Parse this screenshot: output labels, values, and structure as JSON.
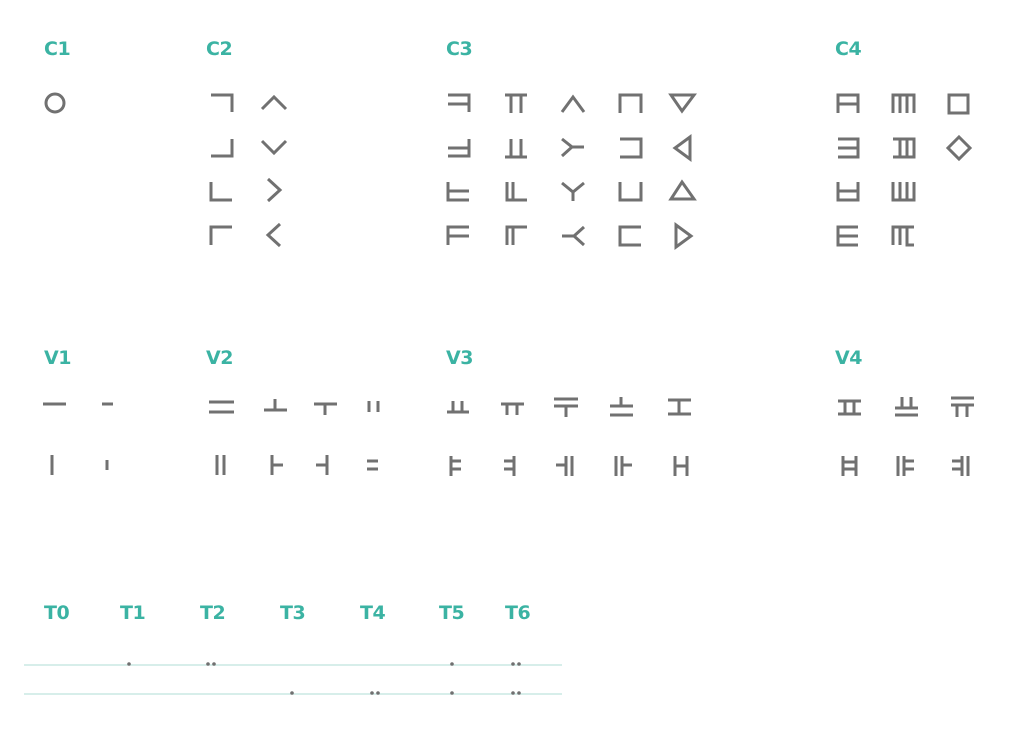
{
  "colors": {
    "accent": "#3bb3a3",
    "glyph": "#717171",
    "rule": "#bfe3dd",
    "dot": "#707070"
  },
  "headers": {
    "c1": "C1",
    "c2": "C2",
    "c3": "C3",
    "c4": "C4",
    "v1": "V1",
    "v2": "V2",
    "v3": "V3",
    "v4": "V4",
    "t0": "T0",
    "t1": "T1",
    "t2": "T2",
    "t3": "T3",
    "t4": "T4",
    "t5": "T5",
    "t6": "T6"
  }
}
